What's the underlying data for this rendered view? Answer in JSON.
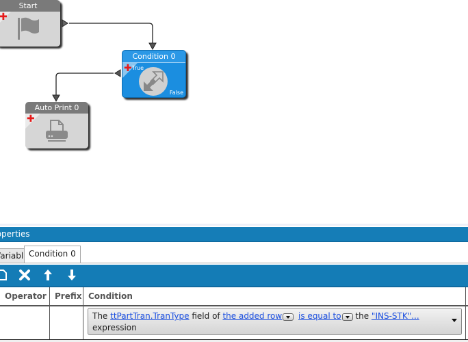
{
  "canvas": {
    "nodes": [
      {
        "id": "start",
        "title": "Start",
        "icon": "flag-icon",
        "style": "gray"
      },
      {
        "id": "condition",
        "title": "Condition 0",
        "icon": "condition-arrows-icon",
        "style": "blue",
        "true_label": "True",
        "false_label": "False"
      },
      {
        "id": "autoprint",
        "title": "Auto Print 0",
        "icon": "printer-icon",
        "style": "gray"
      }
    ],
    "add_glyph": "✚",
    "colors": {
      "node_blue": "#1b8ee0",
      "node_gray": "#d6d6d6",
      "header_gray": "#7a7a7a",
      "add_red": "#e61a1a",
      "panel_blue": "#157db7"
    }
  },
  "properties": {
    "title": "Properties",
    "tabs": [
      {
        "label": "Variables",
        "active": false
      },
      {
        "label": "Condition 0",
        "active": true
      }
    ],
    "toolbar": [
      {
        "name": "new-icon",
        "glyph": "🗋"
      },
      {
        "name": "delete-icon",
        "glyph": "✖"
      },
      {
        "name": "move-up-icon",
        "glyph": "🡅"
      },
      {
        "name": "move-down-icon",
        "glyph": "🡇"
      }
    ],
    "grid": {
      "columns": [
        "Operator",
        "Prefix",
        "Condition"
      ],
      "rows": [
        {
          "operator": "",
          "prefix": "",
          "condition": {
            "t1": "The ",
            "field": "ttPartTran.TranType",
            "t2": " field of ",
            "row": "the added row",
            "op": "is equal to",
            "t3": " the ",
            "value": "\"INS-STK\"...",
            "t4": "expression"
          }
        }
      ]
    }
  }
}
